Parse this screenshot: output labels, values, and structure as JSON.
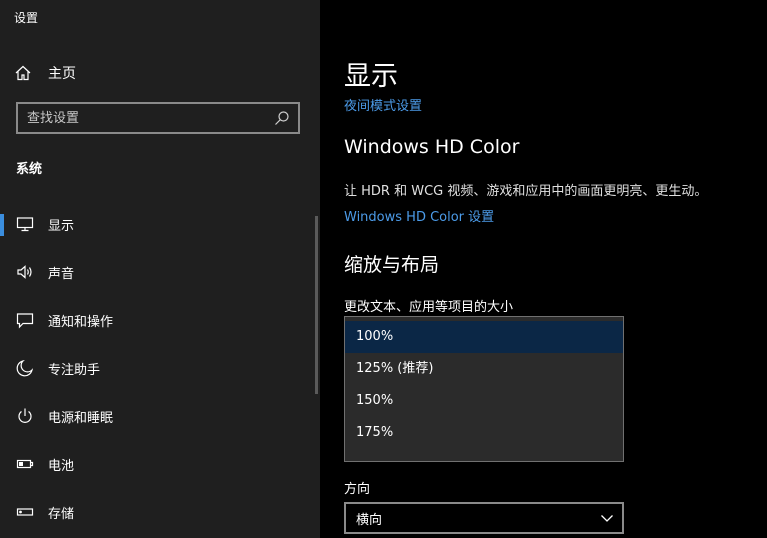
{
  "window": {
    "title": "设置"
  },
  "sidebar": {
    "home_label": "主页",
    "search_placeholder": "查找设置",
    "section": "系统",
    "items": [
      {
        "label": "显示",
        "icon": "monitor-icon",
        "selected": true
      },
      {
        "label": "声音",
        "icon": "speaker-icon"
      },
      {
        "label": "通知和操作",
        "icon": "notification-icon"
      },
      {
        "label": "专注助手",
        "icon": "moon-icon"
      },
      {
        "label": "电源和睡眠",
        "icon": "power-icon"
      },
      {
        "label": "电池",
        "icon": "battery-icon"
      },
      {
        "label": "存储",
        "icon": "storage-icon"
      }
    ]
  },
  "main": {
    "title": "显示",
    "night_light_link": "夜间模式设置",
    "hd_color_title": "Windows HD Color",
    "hd_color_desc": "让 HDR 和 WCG 视频、游戏和应用中的画面更明亮、更生动。",
    "hd_color_link": "Windows HD Color 设置",
    "scale_title": "缩放与布局",
    "scale_label": "更改文本、应用等项目的大小",
    "scale_options": [
      "100%",
      "125% (推荐)",
      "150%",
      "175%"
    ],
    "scale_selected": "100%",
    "orientation_label": "方向",
    "orientation_value": "横向"
  },
  "colors": {
    "accent": "#3b8ede",
    "link": "#4c9be8",
    "sidebar_bg": "#1f1f1f",
    "selected_option_bg": "#0b2746"
  }
}
